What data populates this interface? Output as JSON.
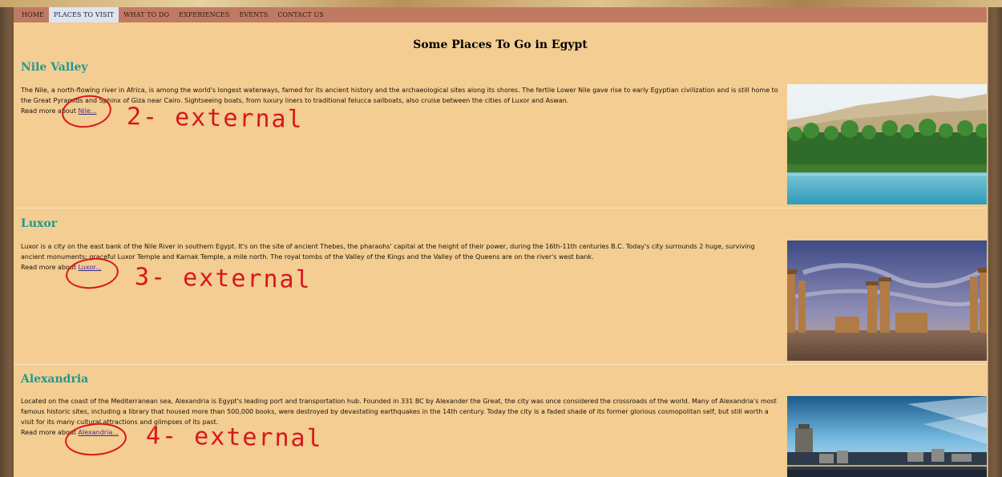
{
  "nav": {
    "items": [
      {
        "label": "HOME"
      },
      {
        "label": "PLACES TO VISIT",
        "active": true
      },
      {
        "label": "WHAT TO DO"
      },
      {
        "label": "EXPERIENCES"
      },
      {
        "label": "EVENTS"
      },
      {
        "label": "CONTACT US"
      }
    ],
    "bar_color": "#c17a62",
    "active_color": "#dfe4f1"
  },
  "page_title": "Some Places To Go in Egypt",
  "sections": [
    {
      "title": "Nile Valley",
      "text": "The Nile, a north-flowing river in Africa, is among the world's longest waterways, famed for its ancient history and the archaeological sites along its shores. The fertile Lower Nile gave rise to early Egyptian civilization and is still home to the Great Pyramids and Sphinx of Giza near Cairo. Sightseeing boats, from luxury liners to traditional felucca sailboats, also cruise between the cities of Luxor and Aswan.",
      "read_more_prefix": "Read more about ",
      "link_label": "Nile...",
      "annotation": "2- external"
    },
    {
      "title": "Luxor",
      "text": "Luxor is a city on the east bank of the Nile River in southern Egypt. It's on the site of ancient Thebes, the pharaohs' capital at the height of their power, during the 16th-11th centuries B.C. Today's city surrounds 2 huge, surviving ancient monuments: graceful Luxor Temple and Karnak Temple, a mile north. The royal tombs of the Valley of the Kings and the Valley of the Queens are on the river's west bank.",
      "read_more_prefix": "Read more about ",
      "link_label": "Luxor...",
      "annotation": "3- external"
    },
    {
      "title": "Alexandria",
      "text": "Located on the coast of the Mediterranean sea, Alexandria is Egypt's leading port and transportation hub. Founded in 331 BC by Alexander the Great, the city was once considered the crossroads of the world. Many of Alexandria's most famous historic sites, including a library that housed more than 500,000 books, were destroyed by devastating earthquakes in the 14th century. Today the city is a faded shade of its former glorious cosmopolitan self, but still worth a visit for its many cultural attractions and glimpses of its past.",
      "read_more_prefix": "Read more about ",
      "link_label": "Alexandria...",
      "annotation": "4- external"
    }
  ],
  "colors": {
    "content_bg": "#f3cd91",
    "section_title": "#1e9a93",
    "annotation": "#d8161c"
  }
}
